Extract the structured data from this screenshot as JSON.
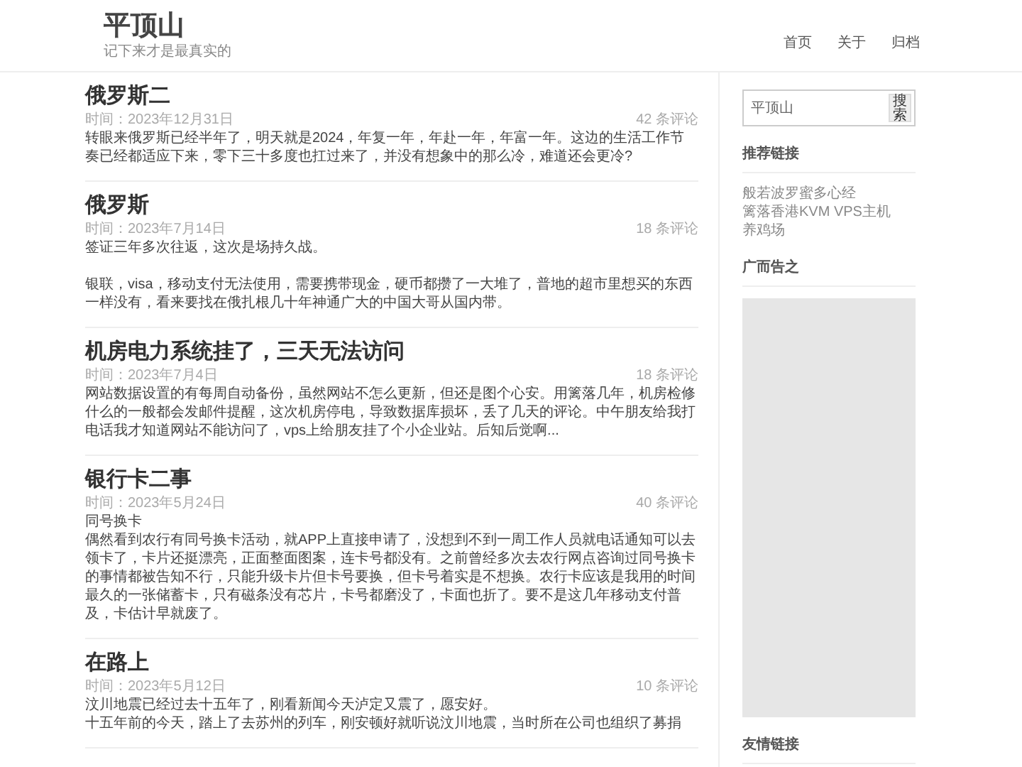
{
  "site": {
    "title": "平顶山",
    "tagline": "记下来才是最真实的"
  },
  "nav": [
    {
      "label": "首页"
    },
    {
      "label": "关于"
    },
    {
      "label": "归档"
    }
  ],
  "posts": [
    {
      "title": "俄罗斯二",
      "date": "时间：2023年12月31日",
      "comments": "42 条评论",
      "paragraphs": [
        {
          "lines": [
            "转眼来俄罗斯已经半年了，明天就是2024，年复一年，年赴一年，年富一年。这边的生活工作节奏已经都适应下来，零下三十多度也扛过来了，并没有想象中的那么冷，难道还会更冷?"
          ]
        }
      ]
    },
    {
      "title": "俄罗斯",
      "date": "时间：2023年7月14日",
      "comments": "18 条评论",
      "paragraphs": [
        {
          "lines": [
            "签证三年多次往返，这次是场持久战。"
          ]
        },
        {
          "lines": [
            "银联，visa，移动支付无法使用，需要携带现金，硬币都攒了一大堆了，普地的超市里想买的东西一样没有，看来要找在俄扎根几十年神通广大的中国大哥从国内带。"
          ]
        }
      ]
    },
    {
      "title": "机房电力系统挂了，三天无法访问",
      "date": "时间：2023年7月4日",
      "comments": "18 条评论",
      "paragraphs": [
        {
          "lines": [
            "网站数据设置的有每周自动备份，虽然网站不怎么更新，但还是图个心安。用篱落几年，机房检修什么的一般都会发邮件提醒，这次机房停电，导致数据库损坏，丢了几天的评论。中午朋友给我打电话我才知道网站不能访问了，vps上给朋友挂了个小企业站。后知后觉啊..."
          ]
        }
      ]
    },
    {
      "title": "银行卡二事",
      "date": "时间：2023年5月24日",
      "comments": "40 条评论",
      "paragraphs": [
        {
          "lines": [
            "同号换卡",
            "偶然看到农行有同号换卡活动，就APP上直接申请了，没想到不到一周工作人员就电话通知可以去领卡了，卡片还挺漂亮，正面整面图案，连卡号都没有。之前曾经多次去农行网点咨询过同号换卡的事情都被告知不行，只能升级卡片但卡号要换，但卡号着实是不想换。农行卡应该是我用的时间最久的一张储蓄卡，只有磁条没有芯片，卡号都磨没了，卡面也折了。要不是这几年移动支付普及，卡估计早就废了。"
          ]
        }
      ]
    },
    {
      "title": "在路上",
      "date": "时间：2023年5月12日",
      "comments": "10 条评论",
      "paragraphs": [
        {
          "lines": [
            "汶川地震已经过去十五年了，刚看新闻今天泸定又震了，愿安好。",
            "十五年前的今天，踏上了去苏州的列车，刚安顿好就听说汶川地震，当时所在公司也组织了募捐"
          ]
        }
      ]
    }
  ],
  "sidebar": {
    "search": {
      "value": "平顶山",
      "button": "搜索"
    },
    "sections": [
      {
        "kind": "links",
        "heading": "推荐链接",
        "links": [
          "般若波罗蜜多心经",
          "篱落香港KVM VPS主机",
          "养鸡场"
        ]
      },
      {
        "kind": "ad",
        "heading": "广而告之"
      },
      {
        "kind": "links",
        "heading": "友情链接"
      }
    ]
  }
}
